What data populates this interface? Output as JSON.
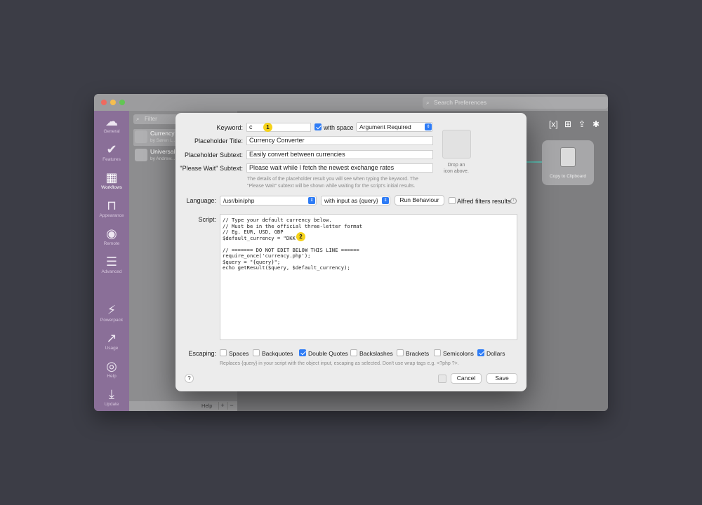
{
  "window": {
    "search_placeholder": "Search Preferences"
  },
  "sidebar": {
    "items": [
      {
        "label": "General",
        "icon": "hat-icon"
      },
      {
        "label": "Features",
        "icon": "checkmark-icon"
      },
      {
        "label": "Workflows",
        "icon": "grid-icon"
      },
      {
        "label": "Appearance",
        "icon": "paint-roller-icon"
      },
      {
        "label": "Remote",
        "icon": "remote-icon"
      },
      {
        "label": "Advanced",
        "icon": "sliders-icon"
      },
      {
        "label": "Powerpack",
        "icon": "battery-icon"
      },
      {
        "label": "Usage",
        "icon": "chart-icon"
      },
      {
        "label": "Help",
        "icon": "lifebuoy-icon"
      },
      {
        "label": "Update",
        "icon": "download-icon"
      }
    ]
  },
  "workflows": {
    "filter_placeholder": "Filter",
    "items": [
      {
        "name": "Currency",
        "author": "by Søren L..."
      },
      {
        "name": "Universal",
        "author": "by Andrew..."
      }
    ],
    "footer_help": "Help",
    "footer_add": "+",
    "footer_remove": "−"
  },
  "canvas": {
    "node_label": "Copy to Clipboard"
  },
  "dialog": {
    "keyword_label": "Keyword:",
    "keyword_value": "c",
    "with_space_label": "with space",
    "with_space_checked": true,
    "argument_option": "Argument Required",
    "placeholder_title_label": "Placeholder Title:",
    "placeholder_title_value": "Currency Converter",
    "placeholder_subtext_label": "Placeholder Subtext:",
    "placeholder_subtext_value": "Easily convert between currencies",
    "please_wait_label": "\"Please Wait\" Subtext:",
    "please_wait_value": "Please wait while I fetch the newest exchange rates",
    "details_note_1": "The details of the placeholder result you will see when typing the keyword. The",
    "details_note_2": "\"Please Wait\" subtext will be shown while waiting for the script's initial results.",
    "drop_icon_text_1": "Drop an",
    "drop_icon_text_2": "icon above.",
    "language_label": "Language:",
    "language_value": "/usr/bin/php",
    "input_mode_value": "with input as {query}",
    "run_behaviour_label": "Run Behaviour",
    "alfred_filters_label": "Alfred filters results",
    "script_label": "Script:",
    "script_lines": [
      "// Type your default currency below.",
      "// Must be in the official three-letter format",
      "// Eg. EUR, USD, GBP",
      "$default_currency = \"DKK\";",
      "",
      "// ======= DO NOT EDIT BELOW THIS LINE ======",
      "require_once('currency.php');",
      "$query = \"{query}\";",
      "echo getResult($query, $default_currency);"
    ],
    "escaping_label": "Escaping:",
    "escaping_options": [
      {
        "label": "Spaces",
        "checked": false
      },
      {
        "label": "Backquotes",
        "checked": false
      },
      {
        "label": "Double Quotes",
        "checked": true
      },
      {
        "label": "Backslashes",
        "checked": false
      },
      {
        "label": "Brackets",
        "checked": false
      },
      {
        "label": "Semicolons",
        "checked": false
      },
      {
        "label": "Dollars",
        "checked": true
      }
    ],
    "escaping_note": "Replaces {query} in your script with the object input, escaping as selected. Don't use wrap tags e.g. <?php ?>.",
    "help_label": "?",
    "cancel_label": "Cancel",
    "save_label": "Save",
    "badge_1": "1",
    "badge_2": "2"
  },
  "colors": {
    "accent": "#2e7cf6",
    "sidebar": "#8a6f98",
    "badge": "#f6d31a"
  }
}
